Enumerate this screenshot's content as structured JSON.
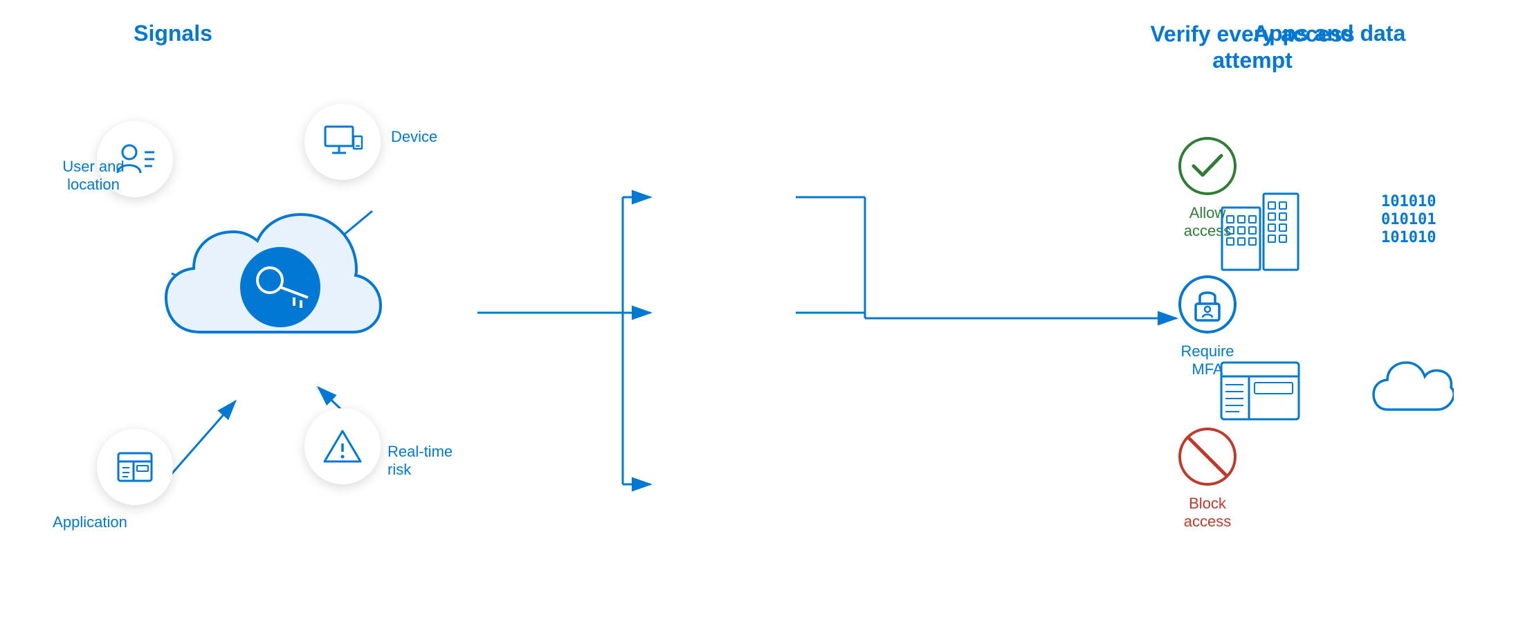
{
  "sections": {
    "signals": {
      "title": "Signals",
      "items": [
        {
          "id": "user-location",
          "label": "User and\nlocation"
        },
        {
          "id": "device",
          "label": "Device"
        },
        {
          "id": "application",
          "label": "Application"
        },
        {
          "id": "realtime-risk",
          "label": "Real-time\nrisk"
        }
      ]
    },
    "verify": {
      "title": "Verify every access\nattempt",
      "items": [
        {
          "id": "allow",
          "label": "Allow access",
          "color": "#2e7d32"
        },
        {
          "id": "mfa",
          "label": "Require MFA",
          "color": "#0078d4"
        },
        {
          "id": "block",
          "label": "Block access",
          "color": "#c0392b"
        }
      ]
    },
    "apps": {
      "title": "Apps and data",
      "items": [
        {
          "id": "building",
          "label": ""
        },
        {
          "id": "data",
          "label": ""
        },
        {
          "id": "app-window",
          "label": ""
        },
        {
          "id": "cloud",
          "label": ""
        }
      ]
    }
  },
  "colors": {
    "blue": "#0078d4",
    "green": "#2e7d32",
    "red": "#c0392b",
    "white": "#ffffff"
  }
}
